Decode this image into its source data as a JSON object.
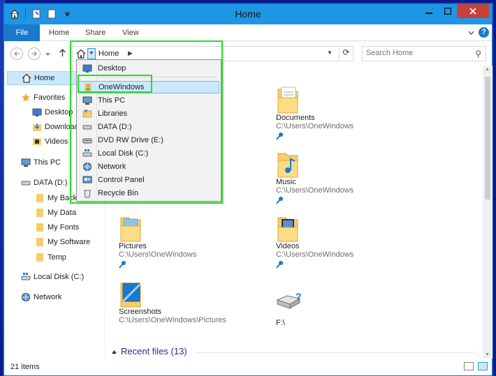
{
  "window": {
    "title": "Home"
  },
  "ribbon": {
    "tabs": [
      "File",
      "Home",
      "Share",
      "View"
    ]
  },
  "address": {
    "crumb": "Home"
  },
  "search": {
    "placeholder": "Search Home"
  },
  "nav": {
    "home": "Home",
    "favorites": "Favorites",
    "favorites_items": [
      "Desktop",
      "Downloads",
      "Videos"
    ],
    "this_pc": "This PC",
    "data_drive": "DATA (D:)",
    "data_items": [
      "My Backups",
      "My Data",
      "My Fonts",
      "My Software",
      "Temp"
    ],
    "local_disk": "Local Disk (C:)",
    "network": "Network"
  },
  "tiles": [
    {
      "name": "Documents",
      "path": "C:\\Users\\OneWindows",
      "icon": "documents-folder-icon",
      "pinned": true
    },
    {
      "name": "Music",
      "path": "C:\\Users\\OneWindows",
      "icon": "music-folder-icon",
      "pinned": true
    },
    {
      "name": "Pictures",
      "path": "C:\\Users\\OneWindows",
      "icon": "pictures-folder-icon",
      "pinned": true
    },
    {
      "name": "Videos",
      "path": "C:\\Users\\OneWindows",
      "icon": "videos-folder-icon",
      "pinned": true
    },
    {
      "name": "Screenshots",
      "path": "C:\\Users\\OneWindows\\Pictures",
      "icon": "screenshots-folder-icon",
      "pinned": false
    },
    {
      "name": "F:\\",
      "path": "",
      "icon": "unknown-drive-icon",
      "pinned": false
    }
  ],
  "recent_files": {
    "label": "Recent files (13)"
  },
  "dropdown": {
    "items": [
      "Desktop",
      "OneWindows",
      "This PC",
      "Libraries",
      "DATA (D:)",
      "DVD RW Drive (E:)",
      "Local Disk (C:)",
      "Network",
      "Control Panel",
      "Recycle Bin"
    ],
    "highlighted": "OneWindows"
  },
  "status": {
    "count": "21 items"
  },
  "colors": {
    "titlebar": "#1e96e6",
    "file_tab": "#1979ca",
    "highlight": "#22e022",
    "folder": "#f5cd6b"
  }
}
